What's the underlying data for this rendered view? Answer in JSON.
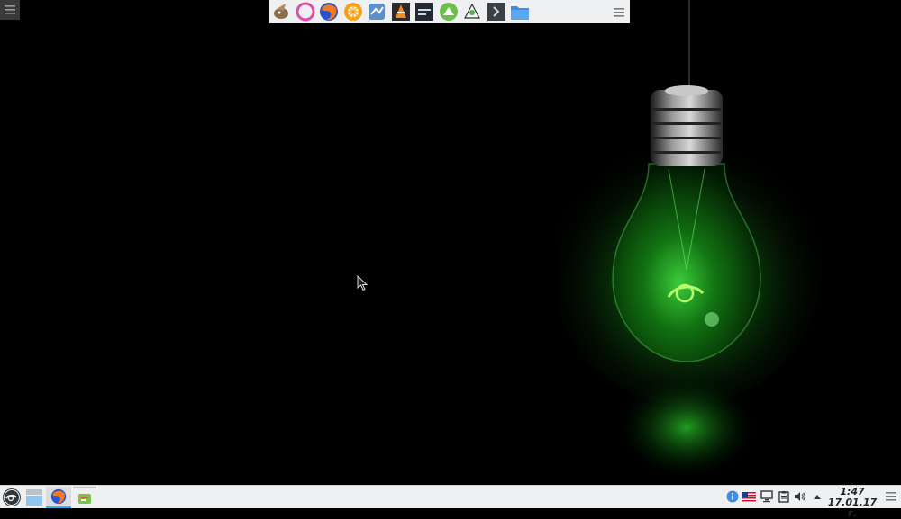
{
  "colors": {
    "panel_bg": "#eff0f1",
    "desktop_bg": "#000000",
    "bulb_glow": "#2ecc40",
    "accent": "#3daee9"
  },
  "dock": {
    "launchers": [
      {
        "name": "gimp-icon"
      },
      {
        "name": "opera-icon"
      },
      {
        "name": "firefox-icon"
      },
      {
        "name": "orange-app-icon"
      },
      {
        "name": "network-app-icon"
      },
      {
        "name": "vlc-icon"
      },
      {
        "name": "kdenlive-icon"
      },
      {
        "name": "gnome-hub-icon"
      },
      {
        "name": "inkscape-icon"
      },
      {
        "name": "terminal-icon"
      },
      {
        "name": "folder-icon"
      }
    ],
    "menu_icon": "hamburger-menu-icon"
  },
  "taskbar": {
    "start_icon": "opensuse-start-icon",
    "tasks": [
      {
        "name": "show-desktop-icon"
      },
      {
        "name": "firefox-task-icon"
      },
      {
        "name": "package-manager-icon"
      }
    ],
    "tray": [
      {
        "name": "info-notification-icon"
      },
      {
        "name": "keyboard-layout-us-flag-icon"
      },
      {
        "name": "display-icon"
      },
      {
        "name": "clipboard-icon"
      },
      {
        "name": "volume-icon"
      },
      {
        "name": "tray-expand-arrow-icon"
      }
    ],
    "clock": {
      "time": "1:47",
      "date": "17.01.17 г."
    },
    "menu_icon": "hamburger-menu-icon"
  }
}
